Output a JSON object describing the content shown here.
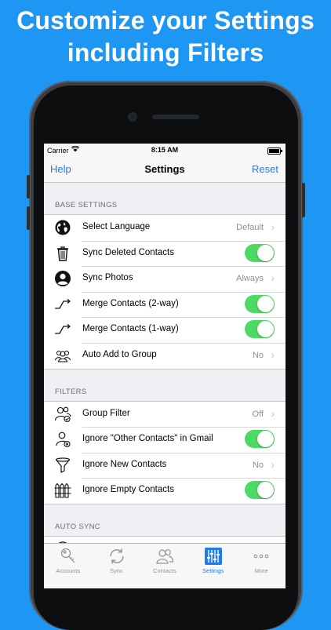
{
  "promo": {
    "headline_line1": "Customize your Settings",
    "headline_line2": "including Filters"
  },
  "status_bar": {
    "carrier": "Carrier",
    "time": "8:15 AM"
  },
  "nav": {
    "left": "Help",
    "title": "Settings",
    "right": "Reset"
  },
  "colors": {
    "background": "#1e96f3",
    "accent": "#1c7cf4",
    "toggle_on": "#4cd964"
  },
  "sections": [
    {
      "header": "BASE SETTINGS",
      "rows": [
        {
          "icon": "globe-icon",
          "label": "Select Language",
          "value": "Default",
          "control": "chevron"
        },
        {
          "icon": "trash-icon",
          "label": "Sync Deleted Contacts",
          "control": "toggle",
          "on": true
        },
        {
          "icon": "person-icon",
          "label": "Sync Photos",
          "value": "Always",
          "control": "chevron"
        },
        {
          "icon": "merge-arrow-icon",
          "label": "Merge Contacts (2-way)",
          "control": "toggle",
          "on": true
        },
        {
          "icon": "merge-arrow-icon",
          "label": "Merge Contacts (1-way)",
          "control": "toggle",
          "on": true
        },
        {
          "icon": "group-icon",
          "label": "Auto Add to Group",
          "value": "No",
          "control": "chevron"
        }
      ]
    },
    {
      "header": "FILTERS",
      "rows": [
        {
          "icon": "group-filter-icon",
          "label": "Group Filter",
          "value": "Off",
          "control": "chevron"
        },
        {
          "icon": "person-x-icon",
          "label": "Ignore \"Other Contacts\" in Gmail",
          "control": "toggle",
          "on": true
        },
        {
          "icon": "funnel-icon",
          "label": "Ignore New Contacts",
          "value": "No",
          "control": "chevron"
        },
        {
          "icon": "fence-icon",
          "label": "Ignore Empty Contacts",
          "control": "toggle",
          "on": true
        }
      ]
    },
    {
      "header": "AUTO SYNC",
      "rows": []
    }
  ],
  "tabs": [
    {
      "label": "Accounts",
      "icon": "key-icon",
      "active": false
    },
    {
      "label": "Sync",
      "icon": "sync-icon",
      "active": false
    },
    {
      "label": "Contacts",
      "icon": "contacts-icon",
      "active": false
    },
    {
      "label": "Settings",
      "icon": "sliders-icon",
      "active": true
    },
    {
      "label": "More",
      "icon": "more-icon",
      "active": false
    }
  ]
}
